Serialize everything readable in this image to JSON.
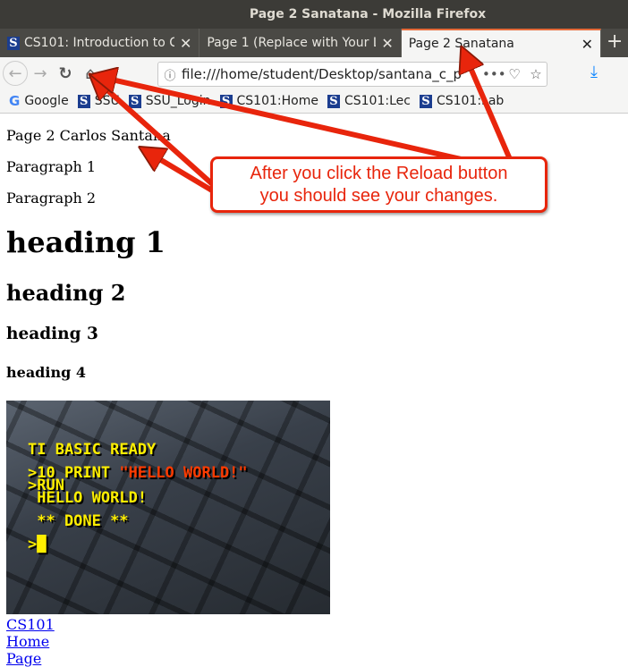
{
  "window": {
    "title": "Page 2 Sanatana - Mozilla Firefox"
  },
  "tabs": [
    {
      "label": "CS101: Introduction to C",
      "favicon": "S",
      "active": false
    },
    {
      "label": "Page 1 (Replace with Your La",
      "active": false
    },
    {
      "label": "Page 2 Sanatana",
      "active": true
    }
  ],
  "nav": {
    "url": "file:///home/student/Desktop/santana_c_p",
    "more": "•••",
    "back_icon": "←",
    "forward_icon": "→",
    "reload_icon": "↻",
    "home_icon": "⌂"
  },
  "bookmarks": [
    {
      "label": "Google",
      "icon": "G"
    },
    {
      "label": "SSU",
      "icon": "S"
    },
    {
      "label": "SSU_Login",
      "icon": "S"
    },
    {
      "label": "CS101:Home",
      "icon": "S"
    },
    {
      "label": "CS101:Lec",
      "icon": "S"
    },
    {
      "label": "CS101:Lab",
      "icon": "S"
    }
  ],
  "page": {
    "title_line": "Page 2 Carlos Santana",
    "p1": "Paragraph 1",
    "p2": "Paragraph 2",
    "h1": "heading 1",
    "h2": "heading 2",
    "h3": "heading 3",
    "h4": "heading 4",
    "image": {
      "line1": "TI BASIC READY",
      "line2a": ">10 PRINT ",
      "line2b": "\"HELLO WORLD!\"",
      "line3": ">RUN",
      "line4": " HELLO WORLD!",
      "line5": " ** DONE **",
      "line6": ">█"
    },
    "link": "CS101 Home Page"
  },
  "annotation": {
    "line1": "After you click the Reload button",
    "line2": "you should see your changes.",
    "color": "#e8250c"
  }
}
